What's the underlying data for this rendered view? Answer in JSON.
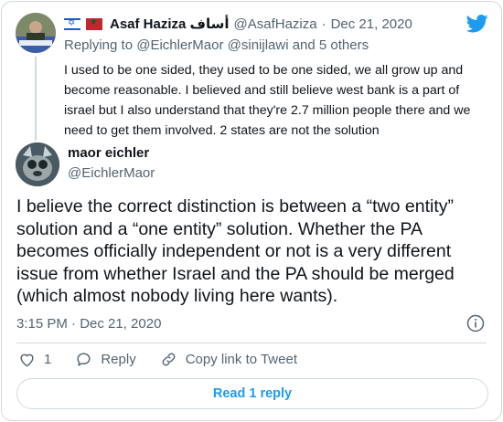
{
  "parent": {
    "name": "Asaf Haziza أساف",
    "handle": "@AsafHaziza",
    "separator": "·",
    "date": "Dec 21, 2020",
    "replying_prefix": "Replying to",
    "replying_to": "@EichlerMaor @sinijlawi",
    "replying_suffix": "and 5 others",
    "text": "I used to be one sided, they used to be one sided, we all grow up and become reasonable. I believed and still believe west bank is a part of israel but I also understand that they're 2.7 million people there and we need to get them involved. 2 states are not the solution"
  },
  "tweet": {
    "name": "maor eichler",
    "handle": "@EichlerMaor",
    "text": "I believe the correct distinction is between a “two entity” solution and a “one entity” solution. Whether the PA becomes officially independent or not is a very different issue from whether Israel and the PA should be merged (which almost nobody living here wants).",
    "time": "3:15 PM · Dec 21, 2020"
  },
  "actions": {
    "like_count": "1",
    "reply_label": "Reply",
    "copy_label": "Copy link to Tweet"
  },
  "read_reply_label": "Read 1 reply",
  "colors": {
    "accent": "#1d9bf0",
    "muted": "#536471",
    "border": "#cfd9de"
  },
  "icons": [
    "twitter-bird-icon",
    "info-icon",
    "heart-icon",
    "reply-icon",
    "link-icon",
    "israel-flag-icon",
    "morocco-flag-icon"
  ]
}
